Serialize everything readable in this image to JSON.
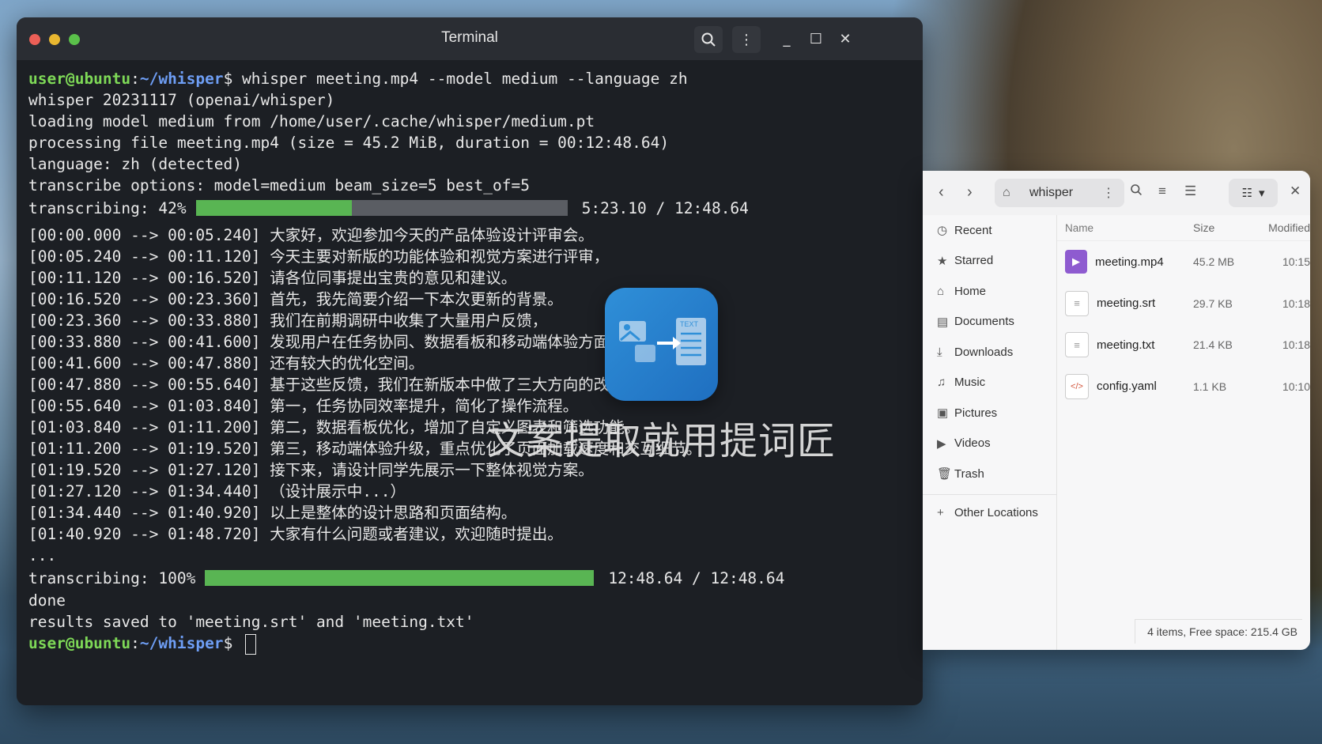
{
  "terminal": {
    "title": "Terminal",
    "prompt_user": "user@ubuntu",
    "prompt_sep": ":",
    "prompt_path": "~/whisper",
    "prompt_dollar": "$",
    "command": " whisper meeting.mp4 --model medium --language zh",
    "header_lines": [
      "whisper 20231117 (openai/whisper)",
      "loading model medium from /home/user/.cache/whisper/medium.pt",
      "processing file meeting.mp4 (size = 45.2 MiB, duration = 00:12:48.64)",
      "language: zh (detected)",
      "transcribe options: model=medium beam_size=5 best_of=5"
    ],
    "progress1": {
      "label": "transcribing: 42%",
      "fraction": 0.42,
      "time": "5:23.10 / 12:48.64"
    },
    "segments": [
      "[00:00.000 --> 00:05.240] 大家好，欢迎参加今天的产品体验设计评审会。",
      "[00:05.240 --> 00:11.120] 今天主要对新版的功能体验和视觉方案进行评审，",
      "[00:11.120 --> 00:16.520] 请各位同事提出宝贵的意见和建议。",
      "[00:16.520 --> 00:23.360] 首先，我先简要介绍一下本次更新的背景。",
      "[00:23.360 --> 00:33.880] 我们在前期调研中收集了大量用户反馈，",
      "[00:33.880 --> 00:41.600] 发现用户在任务协同、数据看板和移动端体验方面",
      "[00:41.600 --> 00:47.880] 还有较大的优化空间。",
      "[00:47.880 --> 00:55.640] 基于这些反馈，我们在新版本中做了三大方向的改进。",
      "[00:55.640 --> 01:03.840] 第一，任务协同效率提升，简化了操作流程。",
      "[01:03.840 --> 01:11.200] 第二，数据看板优化，增加了自定义图表和筛选功能。",
      "[01:11.200 --> 01:19.520] 第三，移动端体验升级，重点优化了页面加载速度和交互细节。",
      "[01:19.520 --> 01:27.120] 接下来，请设计同学先展示一下整体视觉方案。",
      "[01:27.120 --> 01:34.440] （设计展示中...）",
      "[01:34.440 --> 01:40.920] 以上是整体的设计思路和页面结构。",
      "[01:40.920 --> 01:48.720] 大家有什么问题或者建议，欢迎随时提出。"
    ],
    "ellipsis": "...",
    "progress2": {
      "label": "transcribing: 100%",
      "fraction": 1.0,
      "time": "12:48.64 / 12:48.64"
    },
    "done": "done",
    "saved": "results saved to 'meeting.srt' and 'meeting.txt'"
  },
  "files": {
    "path_label": "whisper",
    "sidebar": [
      {
        "label": "Recent",
        "icon": "clock-icon"
      },
      {
        "label": "Starred",
        "icon": "star-icon"
      },
      {
        "label": "Home",
        "icon": "home-icon"
      },
      {
        "label": "Documents",
        "icon": "document-icon"
      },
      {
        "label": "Downloads",
        "icon": "download-icon"
      },
      {
        "label": "Music",
        "icon": "music-icon"
      },
      {
        "label": "Pictures",
        "icon": "picture-icon"
      },
      {
        "label": "Videos",
        "icon": "video-icon"
      },
      {
        "label": "Trash",
        "icon": "trash-icon"
      }
    ],
    "other_locations": "Other Locations",
    "columns": {
      "name": "Name",
      "size": "Size",
      "modified": "Modified"
    },
    "rows": [
      {
        "name": "meeting.mp4",
        "size": "45.2 MB",
        "modified": "10:15",
        "icon": "video-file-icon"
      },
      {
        "name": "meeting.srt",
        "size": "29.7 KB",
        "modified": "10:18",
        "icon": "text-file-icon"
      },
      {
        "name": "meeting.txt",
        "size": "21.4 KB",
        "modified": "10:18",
        "icon": "text-file-icon"
      },
      {
        "name": "config.yaml",
        "size": "1.1 KB",
        "modified": "10:10",
        "icon": "code-file-icon"
      }
    ],
    "status": "4 items, Free space: 215.4 GB"
  },
  "overlay": {
    "logo_text": "TEXT",
    "watermark": "文案提取就用提词匠"
  },
  "colors": {
    "accent_green": "#59b553",
    "prompt_user": "#7ed957",
    "prompt_path": "#6e9ef5",
    "mp4_icon": "#8e5bd0"
  }
}
